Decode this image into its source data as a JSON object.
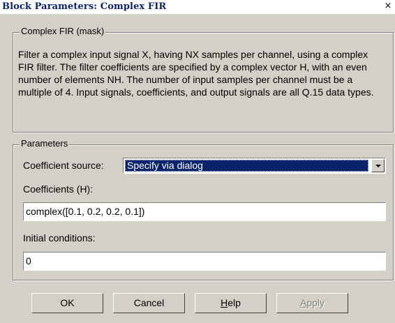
{
  "window": {
    "title": "Block Parameters: Complex FIR",
    "close_glyph": "×"
  },
  "mask_group": {
    "legend": "Complex FIR (mask)",
    "description": "Filter a complex input signal X, having NX samples per channel, using a complex FIR filter. The filter coefficients are specified by a complex vector H, with an even number of elements NH.  The number of input samples per channel must be a multiple of 4.  Input signals, coefficients, and output signals are all Q.15 data types."
  },
  "parameters_group": {
    "legend": "Parameters",
    "coefficient_source_label": "Coefficient source:",
    "coefficient_source_value": "Specify via dialog",
    "coefficients_label": "Coefficients (H):",
    "coefficients_value": "complex([0.1, 0.2, 0.2, 0.1])",
    "initial_conditions_label": "Initial conditions:",
    "initial_conditions_value": "0"
  },
  "buttons": {
    "ok": "OK",
    "cancel": "Cancel",
    "help": "Help",
    "apply": "Apply"
  }
}
